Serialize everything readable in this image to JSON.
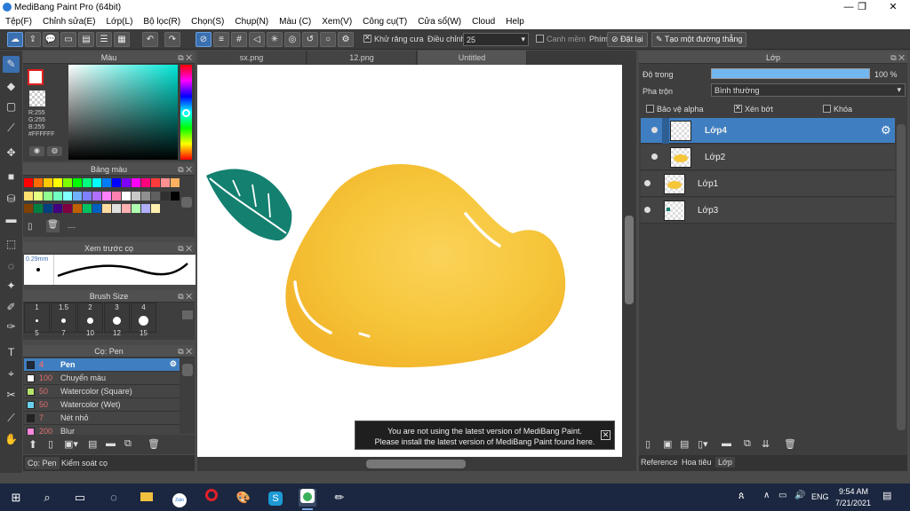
{
  "window": {
    "title": "MediBang Paint Pro (64bit)"
  },
  "menu": [
    "Tệp(F)",
    "Chỉnh sửa(E)",
    "Lớp(L)",
    "Bộ lọc(R)",
    "Chọn(S)",
    "Chụp(N)",
    "Màu (C)",
    "Xem(V)",
    "Công cụ(T)",
    "Cửa sổ(W)",
    "Cloud",
    "Help"
  ],
  "toolbar": {
    "antialias_label": "Khử răng cưa",
    "correction_label": "Điều chỉnh",
    "correction_value": "25",
    "snap_label": "Canh mềm",
    "keys_label": "Phím",
    "reset_label": "Đặt lại",
    "new_line_label": "Tạo một đường thẳng"
  },
  "color_panel": {
    "title": "Màu",
    "r": "R:255",
    "g": "G:255",
    "b": "B:255",
    "hex": "#FFFFFF"
  },
  "palette_panel": {
    "title": "Bảng màu",
    "extra": "---"
  },
  "preview_panel": {
    "title": "Xem trước cọ",
    "size": "0.29mm"
  },
  "brush_size_panel": {
    "title": "Brush Size",
    "sizes": [
      "1",
      "1.5",
      "2",
      "3",
      "4"
    ],
    "sizes2": [
      "5",
      "7",
      "10",
      "12",
      "15"
    ]
  },
  "brush_panel": {
    "title": "Cọ: Pen",
    "brushes": [
      {
        "num": "4",
        "name": "Pen",
        "color": "#1f2a3a"
      },
      {
        "num": "100",
        "name": "Chuyển màu",
        "color": "#ffffff"
      },
      {
        "num": "50",
        "name": "Watercolor (Square)",
        "color": "#b6e36b"
      },
      {
        "num": "50",
        "name": "Watercolor (Wet)",
        "color": "#68d0ee"
      },
      {
        "num": "7",
        "name": "Nét nhỏ",
        "color": "#222222"
      },
      {
        "num": "200",
        "name": "Blur",
        "color": "#ff88dd"
      }
    ]
  },
  "bottom_tabs": {
    "brush": "Cọ: Pen",
    "check": "Kiểm soát cọ"
  },
  "doc_tabs": [
    "sx.png",
    "12.png",
    "Untitled"
  ],
  "notice": {
    "line1": "You are not using the latest version of MediBang Paint.",
    "line2": "Please install the latest version of MediBang Paint found here."
  },
  "layer_panel": {
    "title": "Lớp",
    "opacity_label": "Độ trong",
    "opacity_value": "100 %",
    "blend_label": "Pha trộn",
    "blend_value": "Bình thường",
    "protect_alpha": "Bảo vệ alpha",
    "clipping": "Xén bớt",
    "lock": "Khóa",
    "layers": [
      "Lớp4",
      "Lớp2",
      "Lớp1",
      "Lớp3"
    ]
  },
  "right_tabs": [
    "Reference",
    "Hoa tiêu",
    "Lớp"
  ],
  "taskbar": {
    "time": "9:54 AM",
    "date": "7/21/2021",
    "lang": "ENG",
    "zalo": "Zalo"
  },
  "colors": {
    "accent": "#3f7fc1",
    "mango": "#f7c63a",
    "leaf": "#138070"
  }
}
